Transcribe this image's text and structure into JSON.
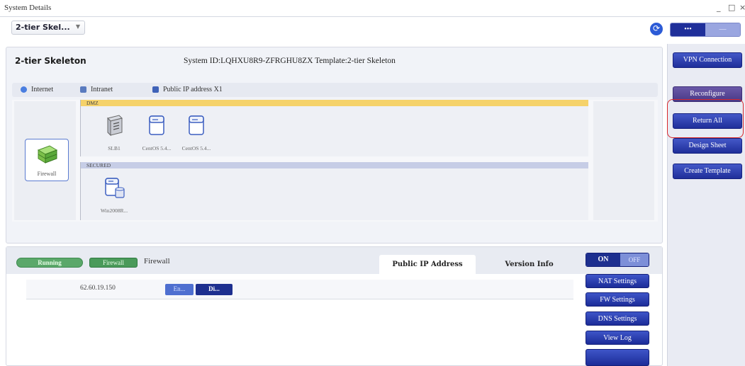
{
  "window": {
    "title": "System Details",
    "controls": [
      "_",
      "□",
      "×"
    ]
  },
  "toolbar": {
    "system_dropdown": "2-tier Skel...",
    "seg_left": "•••",
    "seg_right": "—"
  },
  "system": {
    "name": "2-tier Skeleton",
    "id_line": "System ID:LQHXU8R9-ZFRGHU8ZX  Template:2-tier Skeleton"
  },
  "legend": {
    "internet": "Internet",
    "intranet": "Intranet",
    "public_ip": "Public IP address X1"
  },
  "colors": {
    "accent": "#1f2f9a",
    "dmz": "#f5d26a",
    "secured": "#c6cde6",
    "running": "#5ba86a",
    "highlight": "#d9252a"
  },
  "topology": {
    "firewall_label": "Firewall",
    "dmz": {
      "label": "DMZ",
      "nodes": [
        "SLB1",
        "CentOS 5.4...",
        "CentOS 5.4..."
      ]
    },
    "secured": {
      "label": "SECURED",
      "nodes": [
        "Win2008R..."
      ]
    }
  },
  "lower": {
    "status_pill": "Running",
    "type_pill": "Firewall",
    "name": "Firewall",
    "tabs": [
      "Public IP Address",
      "Version Info"
    ],
    "ip_row": {
      "ip": "62.60.19.150",
      "enable_label": "En...",
      "disable_label": "Di..."
    },
    "on_label": "ON",
    "off_label": "OFF",
    "actions": [
      "NAT Settings",
      "FW Settings",
      "DNS Settings",
      "View Log"
    ]
  },
  "sidebar": {
    "vpn": "VPN Connection",
    "reconfigure": "Reconfigure",
    "return_all": "Return All",
    "design_sheet": "Design Sheet",
    "create_template": "Create Template"
  }
}
